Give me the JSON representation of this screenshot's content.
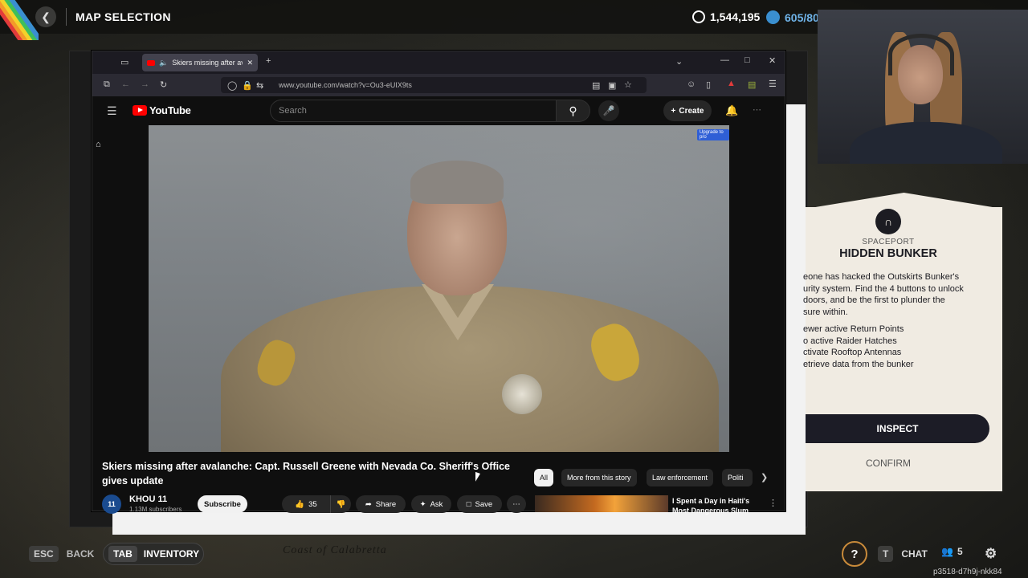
{
  "game": {
    "title": "MAP SELECTION",
    "currency_a": "1,544,195",
    "currency_b": "605/80",
    "map_label": "Coast of Calabretta",
    "session_id": "p3518-d7h9j-nkk84"
  },
  "browser": {
    "tab_title": "Skiers missing after avalanche",
    "url": "www.youtube.com/watch?v=Ou3-eUIX9ts"
  },
  "youtube": {
    "logo_text": "YouTube",
    "search_placeholder": "Search",
    "create_label": "Create",
    "overlay_tag": "Upgrade to pro",
    "video_title": "Skiers missing after avalanche: Capt. Russell Greene with Nevada Co. Sheriff's Office gives update",
    "channel": {
      "logo_text": "11",
      "name": "KHOU 11",
      "subscribers": "1.13M subscribers"
    },
    "subscribe_label": "Subscribe",
    "like_count": "35",
    "share_label": "Share",
    "ask_label": "Ask",
    "save_label": "Save",
    "chips": [
      "All",
      "More from this story",
      "Law enforcement",
      "Politi"
    ],
    "recommended": {
      "title": "I Spent a Day in Haiti's Most Dangerous Slum"
    }
  },
  "mission": {
    "location": "SPACEPORT",
    "title": "HIDDEN BUNKER",
    "description": "eone has hacked the Outskirts Bunker's\nurity system. Find the 4 buttons to unlock\ndoors, and be the first to plunder the\nsure within.",
    "objectives": [
      "ewer active Return Points",
      "o active Raider Hatches",
      "ctivate Rooftop Antennas",
      "etrieve data from the bunker"
    ],
    "inspect_label": "INSPECT",
    "confirm_label": "CONFIRM"
  },
  "bottom_bar": {
    "esc_key": "ESC",
    "back_label": "BACK",
    "tab_key": "TAB",
    "inventory_label": "INVENTORY",
    "help_label": "?",
    "chat_key": "T",
    "chat_label": "CHAT",
    "party_count": "5"
  }
}
